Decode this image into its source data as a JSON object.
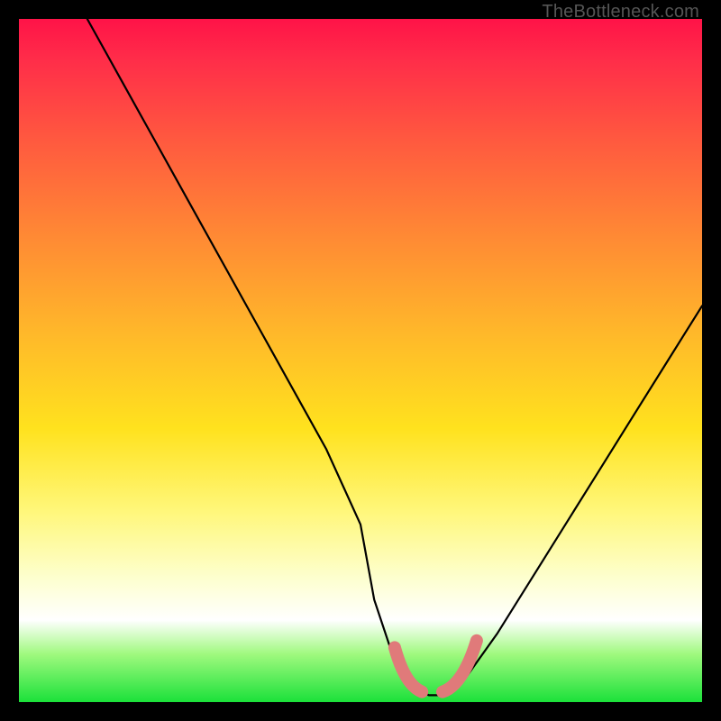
{
  "attribution": "TheBottleneck.com",
  "chart_data": {
    "type": "line",
    "title": "",
    "xlabel": "",
    "ylabel": "",
    "xlim": [
      0,
      100
    ],
    "ylim": [
      0,
      100
    ],
    "series": [
      {
        "name": "bottleneck-curve",
        "x": [
          10,
          15,
          20,
          25,
          30,
          35,
          40,
          45,
          50,
          52,
          55,
          58,
          60,
          62,
          65,
          70,
          75,
          80,
          85,
          90,
          95,
          100
        ],
        "y": [
          100,
          91,
          82,
          73,
          64,
          55,
          46,
          37,
          26,
          15,
          6,
          2,
          1,
          1,
          3,
          10,
          18,
          26,
          34,
          42,
          50,
          58
        ]
      }
    ],
    "optimal_zone": {
      "x_start": 55,
      "x_end": 67,
      "value": 1
    },
    "colors": {
      "curve": "#000000",
      "optimal_marker": "#e07a7a",
      "gradient_top": "#ff1348",
      "gradient_bottom": "#1be13a"
    }
  }
}
